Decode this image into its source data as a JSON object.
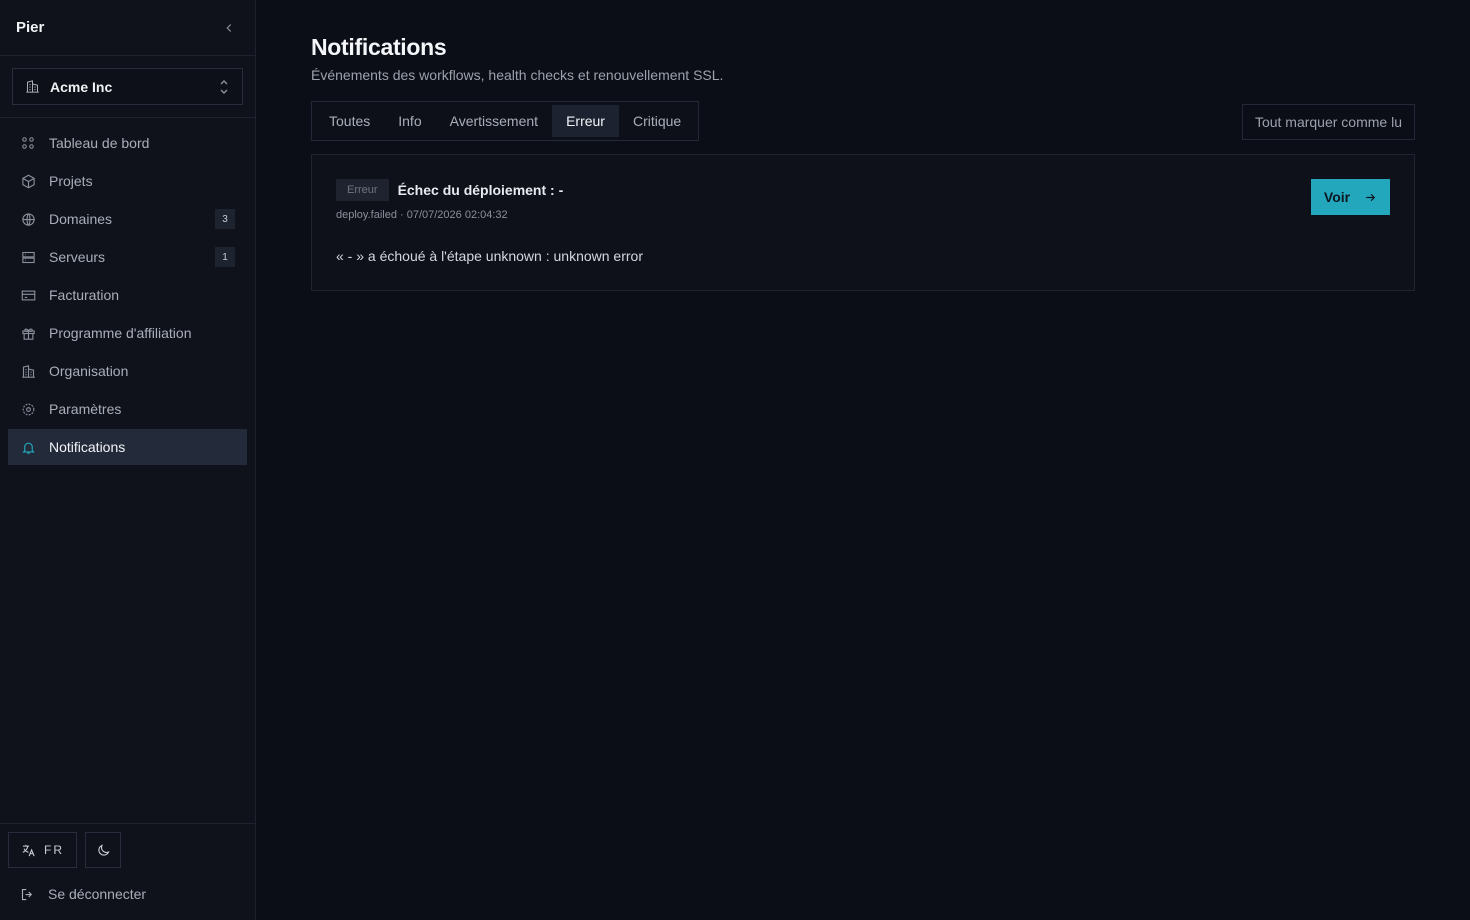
{
  "sidebar": {
    "brand": "Pier",
    "org": {
      "name": "Acme Inc"
    },
    "items": [
      {
        "label": "Tableau de bord",
        "icon": "dashboard-icon"
      },
      {
        "label": "Projets",
        "icon": "box-icon"
      },
      {
        "label": "Domaines",
        "icon": "globe-icon",
        "count": "3"
      },
      {
        "label": "Serveurs",
        "icon": "server-icon",
        "count": "1"
      },
      {
        "label": "Facturation",
        "icon": "credit-card-icon"
      },
      {
        "label": "Programme d'affiliation",
        "icon": "gift-icon"
      },
      {
        "label": "Organisation",
        "icon": "building-icon"
      },
      {
        "label": "Paramètres",
        "icon": "gear-icon"
      },
      {
        "label": "Notifications",
        "icon": "bell-icon",
        "active": true
      }
    ],
    "footer": {
      "lang": "FR",
      "logout": "Se déconnecter"
    }
  },
  "main": {
    "title": "Notifications",
    "subtitle": "Événements des workflows, health checks et renouvellement SSL.",
    "tabs": [
      {
        "label": "Toutes"
      },
      {
        "label": "Info"
      },
      {
        "label": "Avertissement"
      },
      {
        "label": "Erreur",
        "active": true
      },
      {
        "label": "Critique"
      }
    ],
    "mark_all_read": "Tout marquer comme lu",
    "notification": {
      "badge": "Erreur",
      "title": "Échec du déploiement : -",
      "meta": "deploy.failed · 07/07/2026 02:04:32",
      "message": "« - » a échoué à l'étape unknown : unknown error",
      "action": "Voir"
    }
  },
  "colors": {
    "accent": "#22a7bd",
    "background": "#0b0e16",
    "active_item": "#232a3a"
  }
}
